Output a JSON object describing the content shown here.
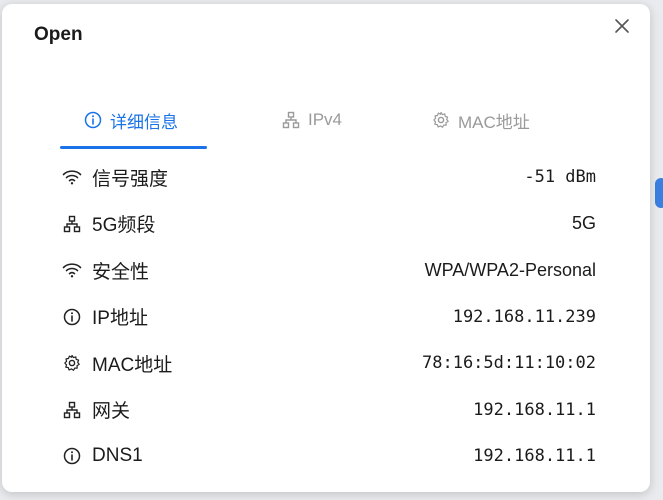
{
  "dialog": {
    "title": "Open"
  },
  "tabs": [
    {
      "label": "详细信息",
      "icon": "info-icon",
      "active": true
    },
    {
      "label": "IPv4",
      "icon": "network-icon",
      "active": false
    },
    {
      "label": "MAC地址",
      "icon": "gear-icon",
      "active": false
    }
  ],
  "details": [
    {
      "label": "信号强度",
      "value": "-51 dBm",
      "icon": "wifi-icon"
    },
    {
      "label": "5G频段",
      "value": "5G",
      "icon": "network-icon"
    },
    {
      "label": "安全性",
      "value": "WPA/WPA2-Personal",
      "icon": "wifi-icon"
    },
    {
      "label": "IP地址",
      "value": "192.168.11.239",
      "icon": "info-icon"
    },
    {
      "label": "MAC地址",
      "value": "78:16:5d:11:10:02",
      "icon": "gear-icon"
    },
    {
      "label": "网关",
      "value": "192.168.11.1",
      "icon": "network-icon"
    },
    {
      "label": "DNS1",
      "value": "192.168.11.1",
      "icon": "info-icon"
    }
  ],
  "colors": {
    "accent": "#1a73e8",
    "inactive_tab": "#9a9a9a",
    "text": "#1b1b1b",
    "dialog_bg": "#ffffff"
  }
}
